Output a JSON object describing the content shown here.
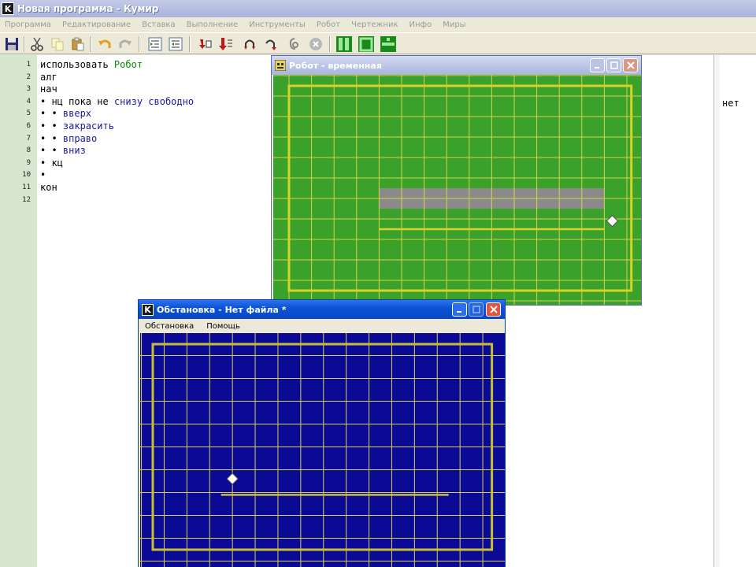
{
  "main": {
    "title": "Новая программа - Кумир",
    "icon_letter": "K"
  },
  "menu": [
    "Программа",
    "Редактирование",
    "Вставка",
    "Выполнение",
    "Инструменты",
    "Робот",
    "Чертежник",
    "Инфо",
    "Миры"
  ],
  "toolbar": {
    "icons": [
      "save-icon",
      "cut-icon",
      "copy-icon",
      "paste-icon",
      "undo-icon",
      "redo-icon",
      "indent-icon",
      "outdent-icon",
      "step-icon",
      "step-into-icon",
      "loop-icon",
      "run-icon",
      "debug-icon",
      "stop-icon",
      "view-columns-icon",
      "view-box-icon",
      "view-split-icon"
    ]
  },
  "editor": {
    "line_numbers": [
      "1",
      "2",
      "3",
      "4",
      "5",
      "6",
      "7",
      "8",
      "9",
      "10",
      "11",
      "12"
    ],
    "lines": [
      {
        "prefix": "",
        "kw": "использовать ",
        "green": "Робот",
        "blue": ""
      },
      {
        "prefix": "",
        "kw": "алг",
        "green": "",
        "blue": ""
      },
      {
        "prefix": "",
        "kw": "нач",
        "green": "",
        "blue": ""
      },
      {
        "prefix": "• ",
        "kw": "нц пока не ",
        "green": "",
        "blue": "снизу свободно"
      },
      {
        "prefix": "• • ",
        "kw": "",
        "green": "",
        "blue": "вверх"
      },
      {
        "prefix": "• • ",
        "kw": "",
        "green": "",
        "blue": "закрасить"
      },
      {
        "prefix": "• • ",
        "kw": "",
        "green": "",
        "blue": "вправо"
      },
      {
        "prefix": "• • ",
        "kw": "",
        "green": "",
        "blue": "вниз"
      },
      {
        "prefix": "• ",
        "kw": "кц",
        "green": "",
        "blue": ""
      },
      {
        "prefix": "•",
        "kw": "",
        "green": "",
        "blue": ""
      },
      {
        "prefix": "",
        "kw": "кон",
        "green": "",
        "blue": ""
      },
      {
        "prefix": "",
        "kw": "",
        "green": "",
        "blue": ""
      }
    ],
    "margin_value": "нет"
  },
  "robot_window": {
    "title": "Робот - временная",
    "field_color": "#3aa12a",
    "grid_color": "#d6d24a",
    "painted_color": "#8a8a8a",
    "wall_color": "#d6d22a",
    "cols": 16,
    "rows": 11,
    "painted_row": 5,
    "painted_cols": [
      4,
      13
    ],
    "robot_cell": [
      14,
      6
    ]
  },
  "env_window": {
    "title": "Обстановка - Нет файла *",
    "menu": [
      "Обстановка",
      "Помощь"
    ],
    "field_color": "#0a0a96",
    "grid_color": "#d6d24a",
    "wall_color": "#c8c030",
    "cols": 16,
    "rows": 10,
    "robot_cell": [
      3,
      6
    ]
  }
}
